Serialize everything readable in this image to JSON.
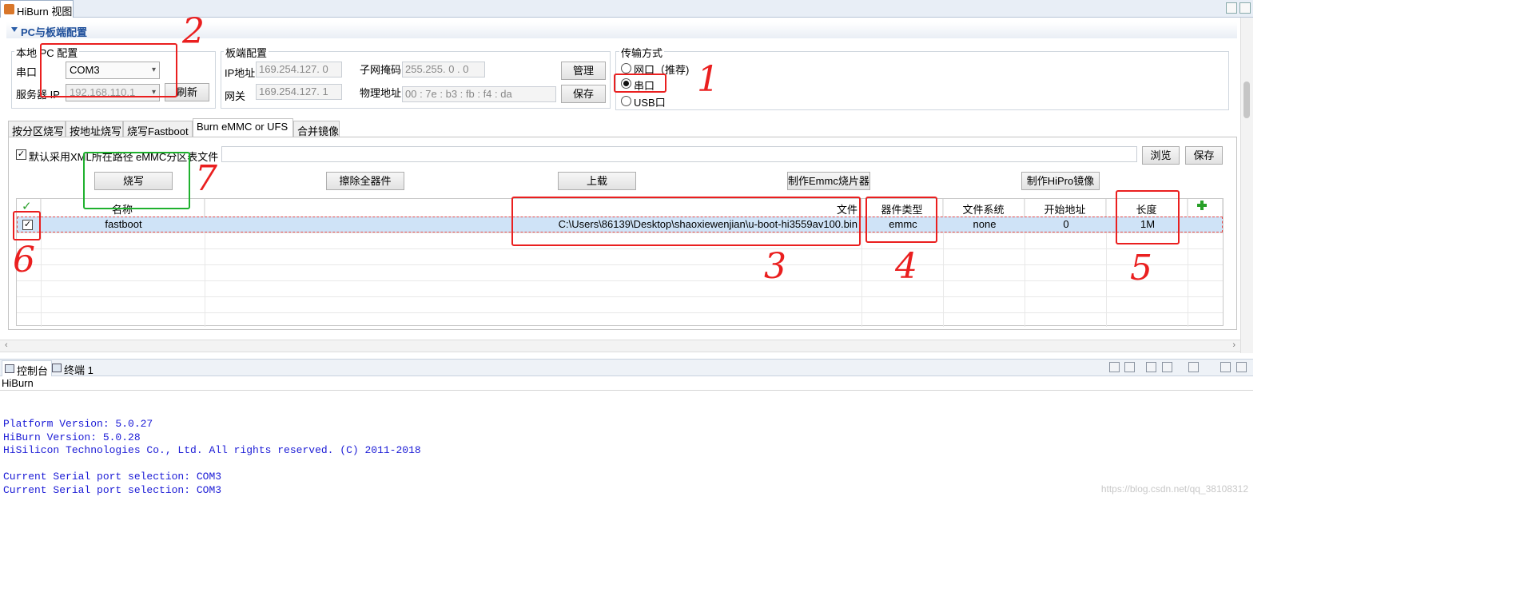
{
  "window": {
    "tab_title": "HiBurn 视图"
  },
  "section": {
    "title": "PC与板端配置"
  },
  "local_pc": {
    "group_label": "本地 PC 配置",
    "serial_label": "串口",
    "serial_value": "COM3",
    "server_ip_label": "服务器 IP",
    "server_ip_value": "192.168.110.1",
    "refresh_button": "刷新"
  },
  "board": {
    "group_label": "板端配置",
    "ip_label": "IP地址",
    "ip_value": "169.254.127.  0",
    "gateway_label": "网关",
    "gateway_value": "169.254.127.  1",
    "subnet_label": "子网掩码",
    "subnet_value": "255.255.  0  .  0",
    "mac_label": "物理地址",
    "mac_value": "00 : 7e : b3 : fb : f4 : da",
    "manage_button": "管理",
    "save_button": "保存"
  },
  "transfer": {
    "group_label": "传输方式",
    "options": [
      "网口（推荐)",
      "串口",
      "USB口"
    ],
    "selected": "串口"
  },
  "tabs": [
    "按分区烧写",
    "按地址烧写",
    "烧写Fastboot",
    "Burn eMMC or UFS",
    "合并镜像"
  ],
  "active_tab": "Burn eMMC or UFS",
  "toolbar": {
    "use_xml_path_label": "默认采用XML所在路径",
    "emmc_table_label": "eMMC分区表文件",
    "emmc_table_value": "",
    "browse_button": "浏览",
    "save_button": "保存",
    "burn_button": "烧写",
    "erase_button": "擦除全器件",
    "upload_button": "上载",
    "make_emmc_button": "制作Emmc烧片器镜像",
    "make_hipro_button": "制作HiPro镜像"
  },
  "table": {
    "headers": [
      "名称",
      "文件",
      "器件类型",
      "文件系统",
      "开始地址",
      "长度"
    ],
    "rows": [
      {
        "checked": true,
        "name": "fastboot",
        "file": "C:\\Users\\86139\\Desktop\\shaoxiewenjian\\u-boot-hi3559av100.bin",
        "device": "emmc",
        "fs": "none",
        "start": "0",
        "length": "1M"
      }
    ]
  },
  "views": {
    "console_tab": "控制台",
    "terminal_tab": "终端 1"
  },
  "console": {
    "title": "HiBurn",
    "lines": [
      "Platform Version: 5.0.27",
      "HiBurn Version: 5.0.28",
      "HiSilicon Technologies Co., Ltd. All rights reserved. (C) 2011-2018",
      "",
      "Current Serial port selection: COM3",
      "Current Serial port selection: COM3"
    ]
  },
  "watermark": "https://blog.csdn.net/qq_38108312",
  "annotations": {
    "n1": "1",
    "n2": "2",
    "n3": "3",
    "n4": "4",
    "n5": "5",
    "n6": "6",
    "n7": "7"
  },
  "colors": {
    "annotation_red": "#ea1f1f",
    "annotation_green": "#1fb12e",
    "console_text": "#1b1bd6",
    "selection": "#cfe3f7"
  }
}
